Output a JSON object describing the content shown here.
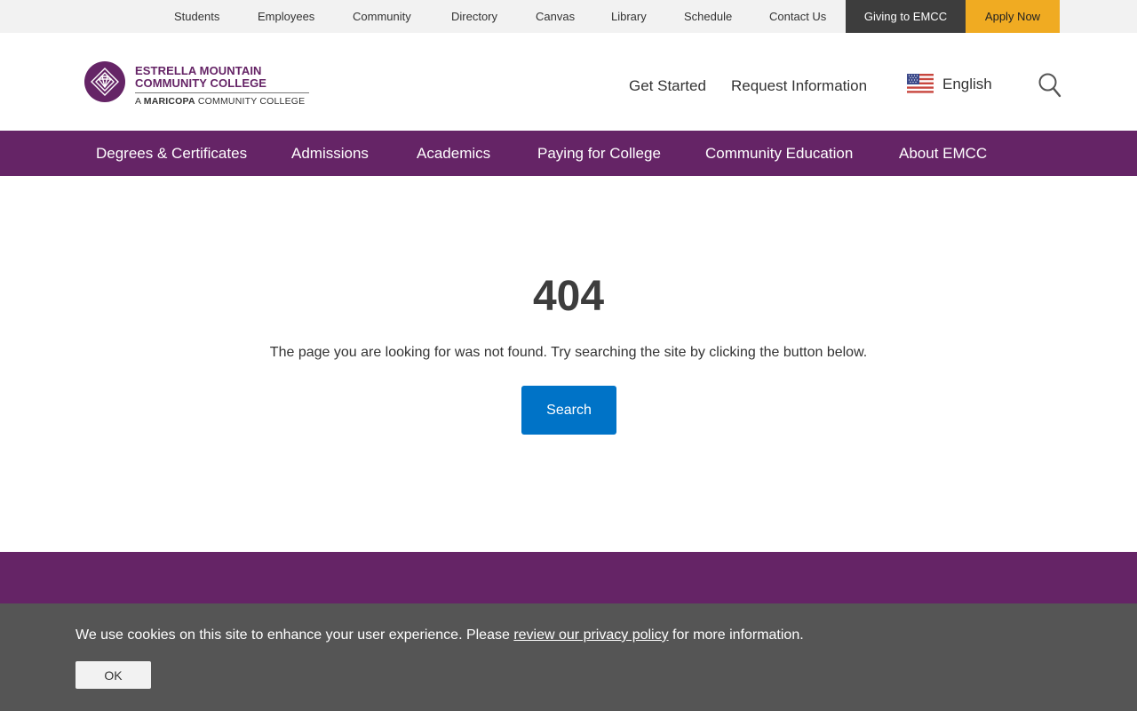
{
  "utility_nav": {
    "items": [
      "Students",
      "Employees",
      "Community",
      "Directory",
      "Canvas",
      "Library",
      "Schedule",
      "Contact Us"
    ],
    "giving_label": "Giving to EMCC",
    "apply_label": "Apply Now"
  },
  "logo": {
    "line1": "ESTRELLA MOUNTAIN",
    "line2": "COMMUNITY COLLEGE",
    "sub_prefix": "A",
    "sub_bold": "MARICOPA",
    "sub_suffix": "COMMUNITY COLLEGE"
  },
  "header": {
    "get_started": "Get Started",
    "request_info": "Request Information",
    "language": "English",
    "search_icon": "search-icon"
  },
  "main_nav": {
    "items": [
      "Degrees & Certificates",
      "Admissions",
      "Academics",
      "Paying for College",
      "Community Education",
      "About EMCC"
    ]
  },
  "error_page": {
    "code": "404",
    "message": "The page you are looking for was not found. Try searching the site by clicking the button below.",
    "search_button": "Search"
  },
  "cookie_banner": {
    "text_before": "We use cookies on this site to enhance your user experience. Please ",
    "link_text": "review our privacy policy",
    "text_after": " for more information.",
    "ok_label": "OK"
  },
  "colors": {
    "brand_purple": "#652466",
    "utility_bg": "#f2f2f2",
    "giving_bg": "#3d3d3d",
    "apply_bg": "#f0ab22",
    "search_button_bg": "#0073c7",
    "cookie_bg": "#555555"
  }
}
